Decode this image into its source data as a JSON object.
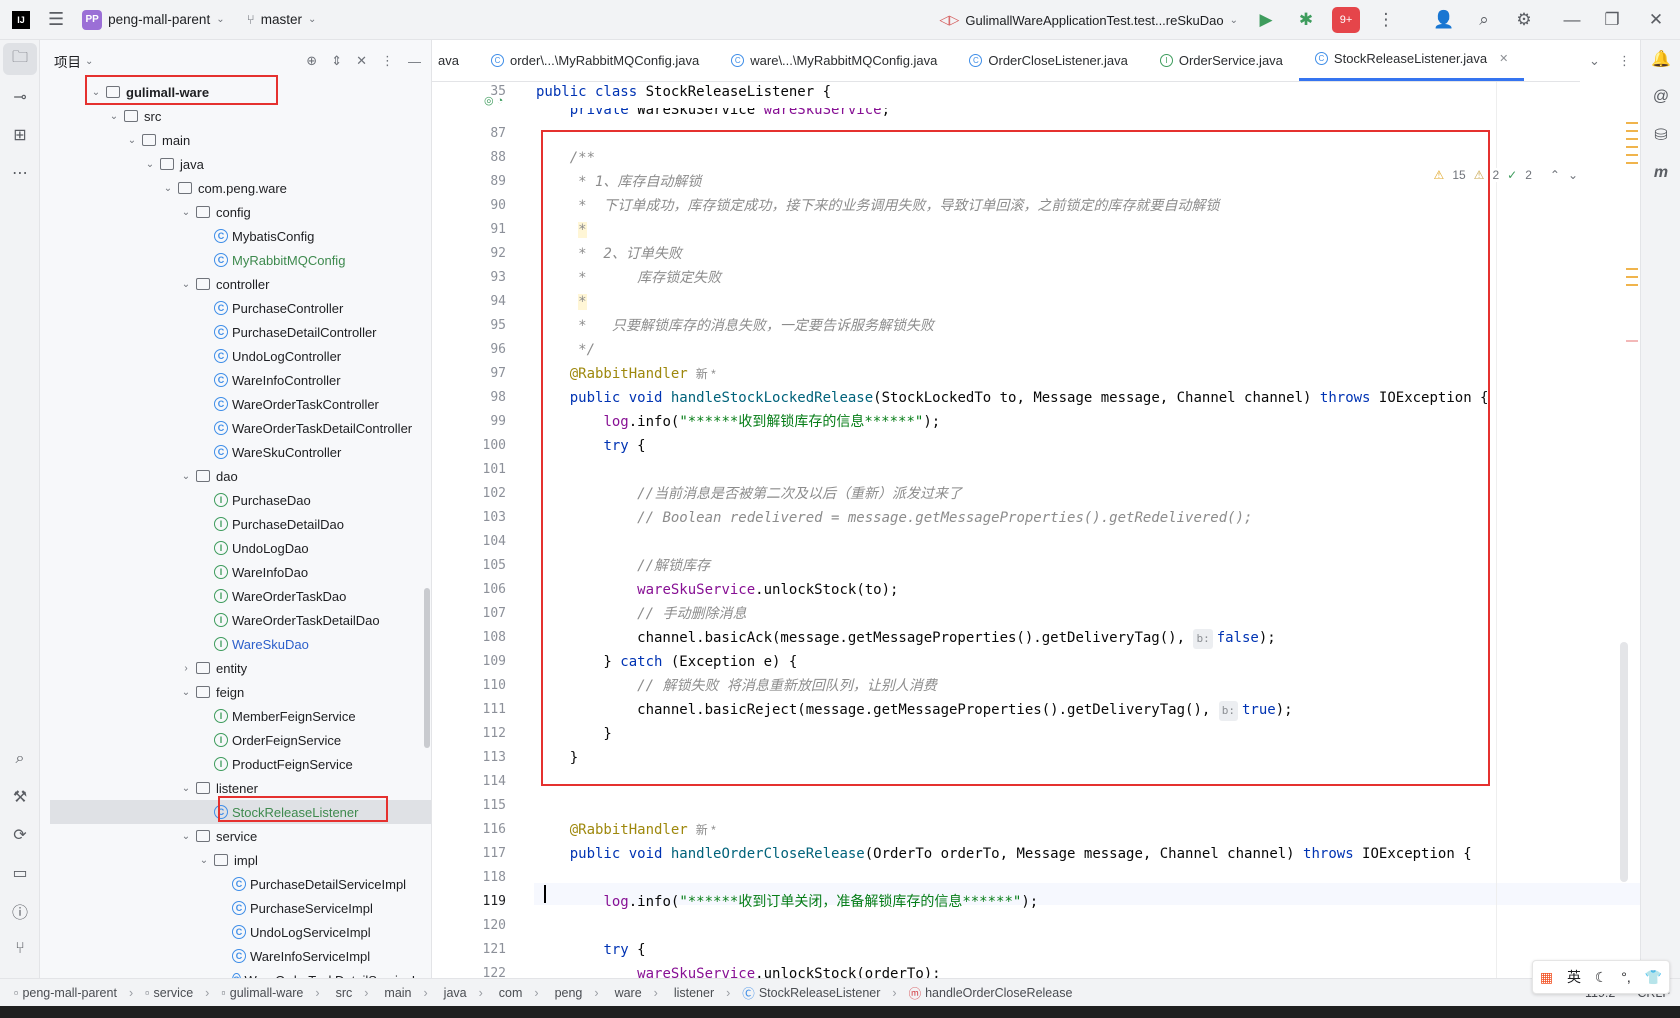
{
  "titlebar": {
    "app_logo": "IJ",
    "project_badge": "PP",
    "project_name": "peng-mall-parent",
    "branch": "master",
    "run_config": "GulimallWareApplicationTest.test...reSkuDao",
    "notif_count": "9+"
  },
  "project_panel": {
    "title": "项目",
    "tree": [
      {
        "label": "gulimall-ware",
        "level": 0,
        "kind": "module",
        "expanded": true,
        "bold": true
      },
      {
        "label": "src",
        "level": 1,
        "kind": "folder",
        "expanded": true
      },
      {
        "label": "main",
        "level": 2,
        "kind": "folder",
        "expanded": true
      },
      {
        "label": "java",
        "level": 3,
        "kind": "folder",
        "expanded": true
      },
      {
        "label": "com.peng.ware",
        "level": 4,
        "kind": "package",
        "expanded": true
      },
      {
        "label": "config",
        "level": 5,
        "kind": "package",
        "expanded": true
      },
      {
        "label": "MybatisConfig",
        "level": 6,
        "kind": "class"
      },
      {
        "label": "MyRabbitMQConfig",
        "level": 6,
        "kind": "class",
        "color": "green"
      },
      {
        "label": "controller",
        "level": 5,
        "kind": "package",
        "expanded": true
      },
      {
        "label": "PurchaseController",
        "level": 6,
        "kind": "class"
      },
      {
        "label": "PurchaseDetailController",
        "level": 6,
        "kind": "class"
      },
      {
        "label": "UndoLogController",
        "level": 6,
        "kind": "class"
      },
      {
        "label": "WareInfoController",
        "level": 6,
        "kind": "class"
      },
      {
        "label": "WareOrderTaskController",
        "level": 6,
        "kind": "class"
      },
      {
        "label": "WareOrderTaskDetailController",
        "level": 6,
        "kind": "class"
      },
      {
        "label": "WareSkuController",
        "level": 6,
        "kind": "class"
      },
      {
        "label": "dao",
        "level": 5,
        "kind": "package",
        "expanded": true
      },
      {
        "label": "PurchaseDao",
        "level": 6,
        "kind": "interface"
      },
      {
        "label": "PurchaseDetailDao",
        "level": 6,
        "kind": "interface"
      },
      {
        "label": "UndoLogDao",
        "level": 6,
        "kind": "interface"
      },
      {
        "label": "WareInfoDao",
        "level": 6,
        "kind": "interface"
      },
      {
        "label": "WareOrderTaskDao",
        "level": 6,
        "kind": "interface"
      },
      {
        "label": "WareOrderTaskDetailDao",
        "level": 6,
        "kind": "interface"
      },
      {
        "label": "WareSkuDao",
        "level": 6,
        "kind": "interface",
        "color": "blue"
      },
      {
        "label": "entity",
        "level": 5,
        "kind": "package",
        "expanded": false
      },
      {
        "label": "feign",
        "level": 5,
        "kind": "package",
        "expanded": true
      },
      {
        "label": "MemberFeignService",
        "level": 6,
        "kind": "interface"
      },
      {
        "label": "OrderFeignService",
        "level": 6,
        "kind": "interface"
      },
      {
        "label": "ProductFeignService",
        "level": 6,
        "kind": "interface"
      },
      {
        "label": "listener",
        "level": 5,
        "kind": "package",
        "expanded": true
      },
      {
        "label": "StockReleaseListener",
        "level": 6,
        "kind": "class",
        "color": "green",
        "selected": true
      },
      {
        "label": "service",
        "level": 5,
        "kind": "package",
        "expanded": true
      },
      {
        "label": "impl",
        "level": 6,
        "kind": "package",
        "expanded": true
      },
      {
        "label": "PurchaseDetailServiceImpl",
        "level": 7,
        "kind": "class"
      },
      {
        "label": "PurchaseServiceImpl",
        "level": 7,
        "kind": "class"
      },
      {
        "label": "UndoLogServiceImpl",
        "level": 7,
        "kind": "class"
      },
      {
        "label": "WareInfoServiceImpl",
        "level": 7,
        "kind": "class"
      },
      {
        "label": "WareOrderTaskDetailServiceImpl",
        "level": 7,
        "kind": "class"
      }
    ]
  },
  "tabs": [
    {
      "label": "ava",
      "icon": "none",
      "partial": true
    },
    {
      "label": "order\\...\\MyRabbitMQConfig.java",
      "icon": "class"
    },
    {
      "label": "ware\\...\\MyRabbitMQConfig.java",
      "icon": "class"
    },
    {
      "label": "OrderCloseListener.java",
      "icon": "class"
    },
    {
      "label": "OrderService.java",
      "icon": "interface"
    },
    {
      "label": "StockReleaseListener.java",
      "icon": "class",
      "active": true
    }
  ],
  "inspections": {
    "warnings": "15",
    "weak": "2",
    "ok": "2"
  },
  "editor": {
    "lines": [
      {
        "n": "35",
        "html": "<span class=\"kw\">public class</span> StockReleaseListener {"
      },
      {
        "n": "",
        "html": "    <span class=\"kw\">private</span> WareSkuService <span class=\"fld\">wareSkuService</span>;"
      },
      {
        "n": "87",
        "html": ""
      },
      {
        "n": "88",
        "html": "    <span class=\"cmt\">/**</span>"
      },
      {
        "n": "89",
        "html": "<span class=\"cmt\">     * 1、库存自动解锁</span>"
      },
      {
        "n": "90",
        "html": "<span class=\"cmt\">     *  下订单成功，库存锁定成功，接下来的业务调用失败，导致订单回滚，之前锁定的库存就要自动解锁</span>"
      },
      {
        "n": "91",
        "html": "<span class=\"cmt\">     <span class=\"hlstar\">*</span></span>"
      },
      {
        "n": "92",
        "html": "<span class=\"cmt\">     *  2、订单失败</span>"
      },
      {
        "n": "93",
        "html": "<span class=\"cmt\">     *      库存锁定失败</span>"
      },
      {
        "n": "94",
        "html": "<span class=\"cmt\">     <span class=\"hlstar\">*</span></span>"
      },
      {
        "n": "95",
        "html": "<span class=\"cmt\">     *   只要解锁库存的消息失败，一定要告诉服务解锁失败</span>"
      },
      {
        "n": "96",
        "html": "<span class=\"cmt\">     */</span>"
      },
      {
        "n": "97",
        "html": "    <span class=\"ann\">@RabbitHandler</span><span class=\"inlay\">新 *</span>"
      },
      {
        "n": "98",
        "html": "    <span class=\"kw\">public void</span> <span class=\"fn\">handleStockLockedRelease</span>(StockLockedTo to, Message message, Channel channel) <span class=\"kw\">throws</span> IOException {"
      },
      {
        "n": "99",
        "html": "        <span class=\"fld\">log</span>.info(<span class=\"str\">\"******收到解锁库存的信息******\"</span>);"
      },
      {
        "n": "100",
        "html": "        <span class=\"kw\">try</span> {"
      },
      {
        "n": "101",
        "html": ""
      },
      {
        "n": "102",
        "html": "            <span class=\"cmt\">//当前消息是否被第二次及以后（重新）派发过来了</span>"
      },
      {
        "n": "103",
        "html": "            <span class=\"cmt\">// Boolean redelivered = message.getMessageProperties().getRedelivered();</span>"
      },
      {
        "n": "104",
        "html": ""
      },
      {
        "n": "105",
        "html": "            <span class=\"cmt\">//解锁库存</span>"
      },
      {
        "n": "106",
        "html": "            <span class=\"fld\">wareSkuService</span>.unlockStock(to);"
      },
      {
        "n": "107",
        "html": "            <span class=\"cmt\">// 手动删除消息</span>"
      },
      {
        "n": "108",
        "html": "            channel.basicAck(message.getMessageProperties().getDeliveryTag(), <span class=\"hint\">b:</span><span class=\"kw\">false</span>);"
      },
      {
        "n": "109",
        "html": "        } <span class=\"kw\">catch</span> (Exception e) {"
      },
      {
        "n": "110",
        "html": "            <span class=\"cmt\">// 解锁失败 将消息重新放回队列，让别人消费</span>"
      },
      {
        "n": "111",
        "html": "            channel.basicReject(message.getMessageProperties().getDeliveryTag(), <span class=\"hint\">b:</span><span class=\"kw\">true</span>);"
      },
      {
        "n": "112",
        "html": "        }"
      },
      {
        "n": "113",
        "html": "    }"
      },
      {
        "n": "114",
        "html": ""
      },
      {
        "n": "115",
        "html": ""
      },
      {
        "n": "116",
        "html": "    <span class=\"ann\">@RabbitHandler</span><span class=\"inlay\">新 *</span>"
      },
      {
        "n": "117",
        "html": "    <span class=\"kw\">public void</span> <span class=\"fn\">handleOrderCloseRelease</span>(OrderTo orderTo, Message message, Channel channel) <span class=\"kw\">throws</span> IOException {"
      },
      {
        "n": "118",
        "html": ""
      },
      {
        "n": "119",
        "html": "        <span class=\"fld\">log</span>.info(<span class=\"str\">\"******收到订单关闭，准备解锁库存的信息******\"</span>);"
      },
      {
        "n": "120",
        "html": ""
      },
      {
        "n": "121",
        "html": "        <span class=\"kw\">try</span> {"
      },
      {
        "n": "122",
        "html": "            <span class=\"fld\">wareSkuService</span>.unlockStock(orderTo);"
      }
    ]
  },
  "statusbar": {
    "breadcrumbs": [
      "peng-mall-parent",
      "service",
      "gulimall-ware",
      "src",
      "main",
      "java",
      "com",
      "peng",
      "ware",
      "listener",
      "StockReleaseListener",
      "handleOrderCloseRelease"
    ],
    "position": "119:2",
    "line_sep": "CRLF"
  },
  "ime": {
    "lang": "英"
  }
}
